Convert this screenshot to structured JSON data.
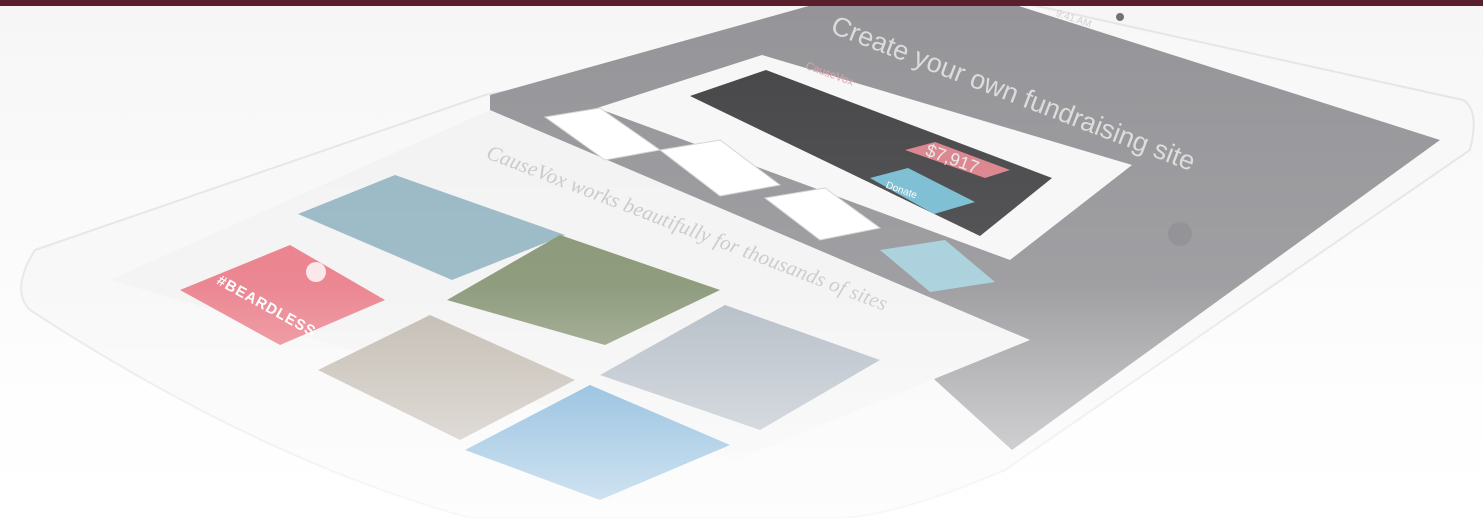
{
  "colors": {
    "topbar": "#5a1f2c",
    "screen_dark": "#8e8e92",
    "panel_dark": "#2b2b2f",
    "accent_blue": "#3ea7c8",
    "accent_red": "#e0465d",
    "white": "#ffffff"
  },
  "hero": {
    "title": "Create your own fundraising site"
  },
  "status": {
    "time": "9:41 AM"
  },
  "site_preview": {
    "logo_text": "CauseVox",
    "headline": "CauseVox works beautifully for thousands of sites",
    "amount": "$7,917",
    "donate_label": "Donate"
  },
  "cards": [
    {
      "label": "#BEARDLESS",
      "icon": "heart-badge-icon"
    }
  ]
}
